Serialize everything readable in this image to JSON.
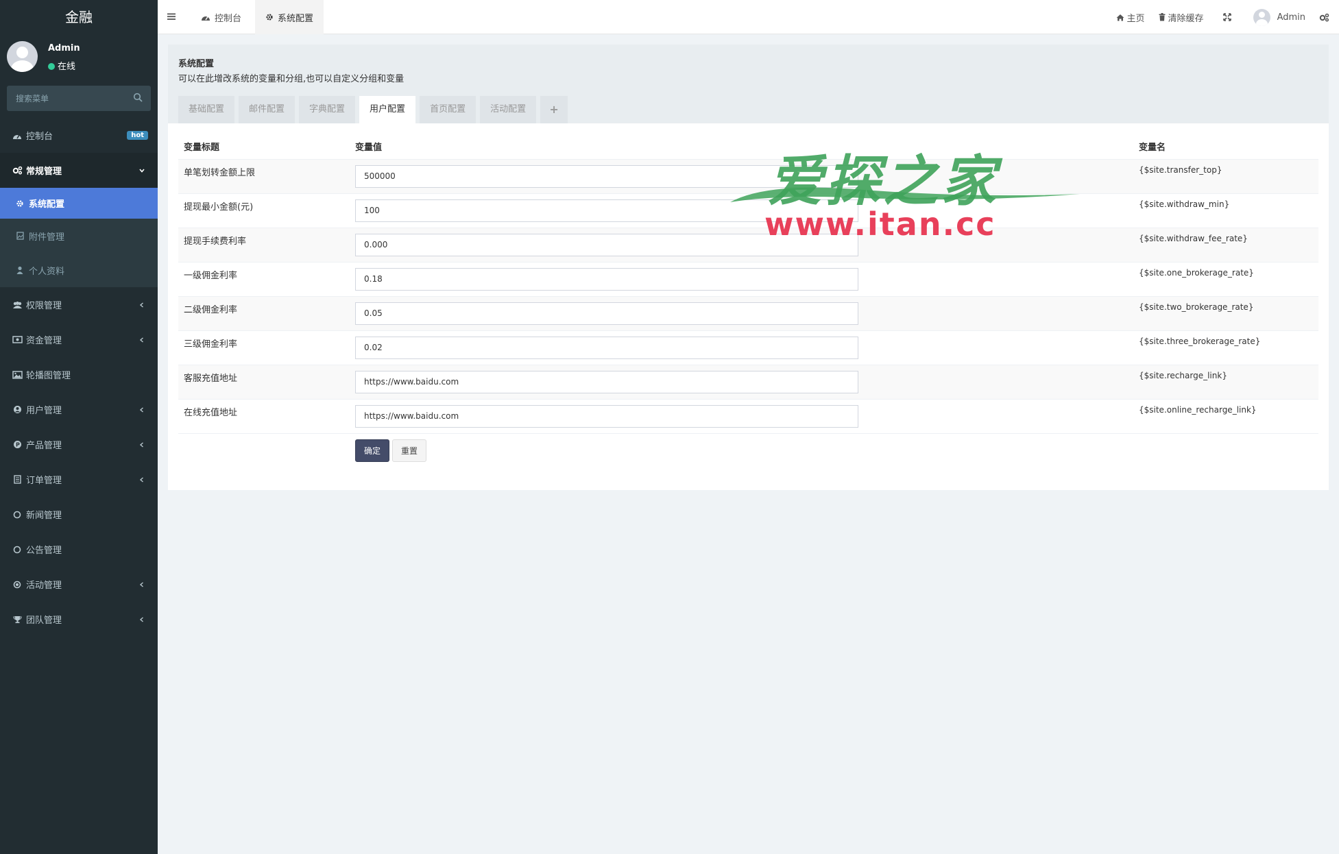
{
  "app": {
    "logo": "金融"
  },
  "user": {
    "name": "Admin",
    "status": "在线"
  },
  "sidebar": {
    "search_placeholder": "搜索菜单",
    "items": [
      {
        "label": "控制台",
        "icon": "dashboard-icon",
        "badge": "hot"
      },
      {
        "label": "常规管理",
        "icon": "cogs-icon",
        "expanded": true,
        "children": [
          {
            "label": "系统配置",
            "icon": "gear-icon",
            "active": true
          },
          {
            "label": "附件管理",
            "icon": "file-image-icon"
          },
          {
            "label": "个人资料",
            "icon": "user-icon"
          }
        ]
      },
      {
        "label": "权限管理",
        "icon": "group-icon"
      },
      {
        "label": "资金管理",
        "icon": "money-icon"
      },
      {
        "label": "轮播图管理",
        "icon": "image-icon"
      },
      {
        "label": "用户管理",
        "icon": "user-circle-icon"
      },
      {
        "label": "产品管理",
        "icon": "product-icon"
      },
      {
        "label": "订单管理",
        "icon": "list-icon"
      },
      {
        "label": "新闻管理",
        "icon": "circle-icon"
      },
      {
        "label": "公告管理",
        "icon": "circle-icon"
      },
      {
        "label": "活动管理",
        "icon": "play-circle-icon"
      },
      {
        "label": "团队管理",
        "icon": "trophy-icon"
      }
    ]
  },
  "header": {
    "tabs": [
      {
        "label": "控制台",
        "icon": "dashboard-icon"
      },
      {
        "label": "系统配置",
        "icon": "gear-icon",
        "active": true
      }
    ],
    "right": {
      "home": "主页",
      "clear_cache": "清除缓存",
      "user": "Admin"
    }
  },
  "panel": {
    "title": "系统配置",
    "subtitle": "可以在此增改系统的变量和分组,也可以自定义分组和变量",
    "tabs": [
      "基础配置",
      "邮件配置",
      "字典配置",
      "用户配置",
      "首页配置",
      "活动配置"
    ],
    "active_tab": "用户配置",
    "table": {
      "headers": [
        "变量标题",
        "变量值",
        "变量名"
      ],
      "rows": [
        {
          "title": "单笔划转金额上限",
          "value": "500000",
          "name": "{$site.transfer_top}"
        },
        {
          "title": "提现最小金额(元)",
          "value": "100",
          "name": "{$site.withdraw_min}"
        },
        {
          "title": "提现手续费利率",
          "value": "0.000",
          "name": "{$site.withdraw_fee_rate}"
        },
        {
          "title": "一级佣金利率",
          "value": "0.18",
          "name": "{$site.one_brokerage_rate}"
        },
        {
          "title": "二级佣金利率",
          "value": "0.05",
          "name": "{$site.two_brokerage_rate}"
        },
        {
          "title": "三级佣金利率",
          "value": "0.02",
          "name": "{$site.three_brokerage_rate}"
        },
        {
          "title": "客服充值地址",
          "value": "https://www.baidu.com",
          "name": "{$site.recharge_link}"
        },
        {
          "title": "在线充值地址",
          "value": "https://www.baidu.com",
          "name": "{$site.online_recharge_link}"
        }
      ]
    },
    "buttons": {
      "submit": "确定",
      "reset": "重置"
    }
  },
  "watermark": {
    "text": "爱探之家",
    "url": "www.itan.cc"
  },
  "colors": {
    "sidebar_bg": "#222d32",
    "active_item": "#4d7ad9",
    "primary_button": "#444c69",
    "badge": "#3c8dbc",
    "online": "#33cc99"
  }
}
